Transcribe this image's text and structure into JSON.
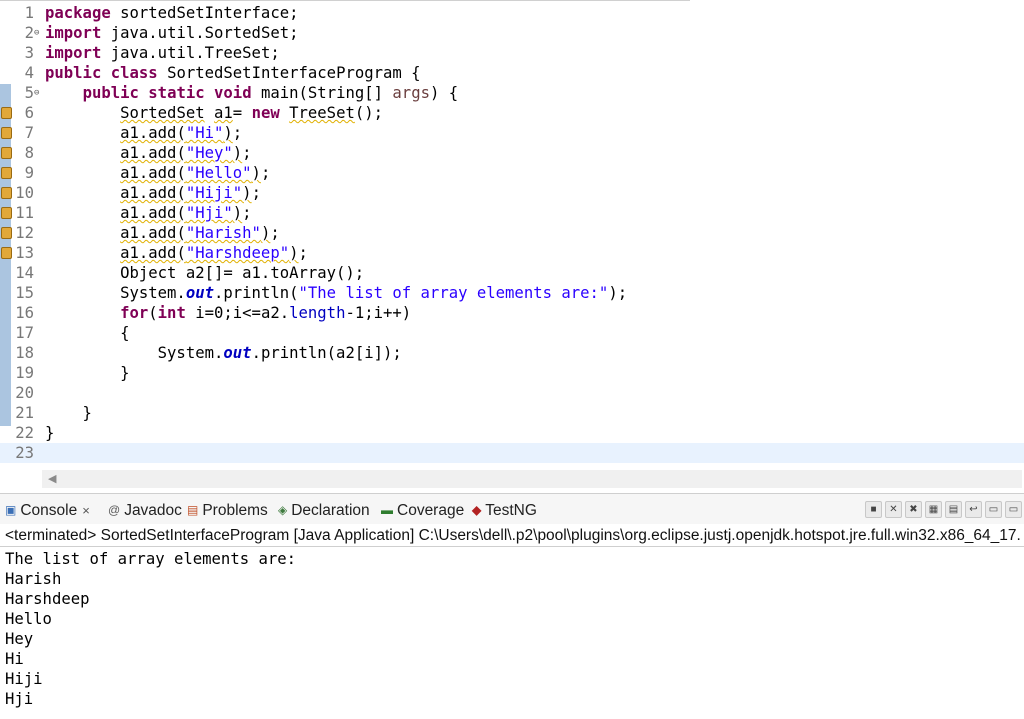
{
  "editor": {
    "package_name": "sortedSetInterface",
    "imports": [
      "java.util.SortedSet",
      "java.util.TreeSet"
    ],
    "class_name": "SortedSetInterfaceProgram",
    "adds": [
      "\"Hi\"",
      "\"Hey\"",
      "\"Hello\"",
      "\"Hiji\"",
      "\"Hji\"",
      "\"Harish\"",
      "\"Harshdeep\""
    ],
    "print_string": "\"The list of array elements are:\"",
    "line_numbers": [
      "1",
      "2",
      "3",
      "4",
      "5",
      "6",
      "7",
      "8",
      "9",
      "10",
      "11",
      "12",
      "13",
      "14",
      "15",
      "16",
      "17",
      "18",
      "19",
      "20",
      "21",
      "22",
      "23"
    ]
  },
  "console": {
    "tabs": [
      {
        "label": "Console",
        "icon": "console-icon"
      },
      {
        "label": "Javadoc",
        "icon": "javadoc-icon"
      },
      {
        "label": "Problems",
        "icon": "problems-icon"
      },
      {
        "label": "Declaration",
        "icon": "declaration-icon"
      },
      {
        "label": "Coverage",
        "icon": "coverage-icon"
      },
      {
        "label": "TestNG",
        "icon": "testng-icon"
      }
    ],
    "close_glyph": "×",
    "title": "<terminated> SortedSetInterfaceProgram [Java Application] C:\\Users\\dell\\.p2\\pool\\plugins\\org.eclipse.justj.openjdk.hotspot.jre.full.win32.x86_64_17.",
    "output": [
      "The list of array elements are:",
      "Harish",
      "Harshdeep",
      "Hello",
      "Hey",
      "Hi",
      "Hiji",
      "Hji"
    ]
  },
  "colors": {
    "keyword": "#7f0055",
    "string": "#2a00ff",
    "field": "#0000c0",
    "current_line": "#e8f2fe"
  }
}
